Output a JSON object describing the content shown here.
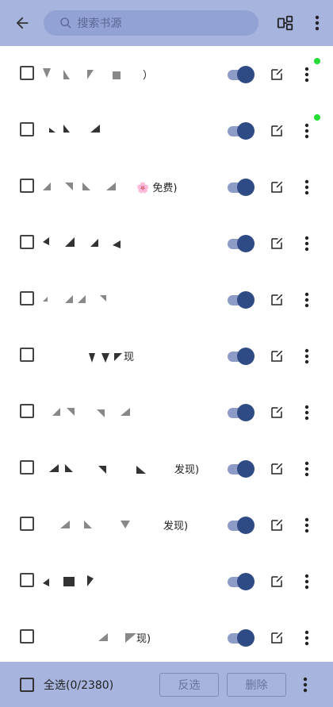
{
  "header": {
    "back_icon": "arrow-back-icon",
    "search_placeholder": "搜索书源",
    "search_icon": "search-icon",
    "group_icon": "group-icon",
    "menu_icon": "more-vertical-icon"
  },
  "rows": [
    {
      "name_suffix": "）",
      "enabled": true,
      "has_dot": true
    },
    {
      "name_suffix": "",
      "enabled": true,
      "has_dot": true
    },
    {
      "name_suffix": "🌸 免费)",
      "enabled": true,
      "has_dot": false
    },
    {
      "name_suffix": "",
      "enabled": true,
      "has_dot": false
    },
    {
      "name_suffix": "",
      "enabled": true,
      "has_dot": false
    },
    {
      "name_suffix": "现",
      "enabled": true,
      "has_dot": false
    },
    {
      "name_suffix": "",
      "enabled": true,
      "has_dot": false
    },
    {
      "name_suffix": "发现)",
      "enabled": true,
      "has_dot": false
    },
    {
      "name_suffix": "发现)",
      "enabled": true,
      "has_dot": false
    },
    {
      "name_suffix": "",
      "enabled": true,
      "has_dot": false
    },
    {
      "name_suffix": "现)",
      "enabled": true,
      "has_dot": false
    }
  ],
  "footer": {
    "select_all": "全选(0/2380)",
    "invert_label": "反选",
    "delete_label": "删除",
    "menu_icon": "more-vertical-icon"
  },
  "colors": {
    "bar_background": "#a6b4de",
    "toggle_on": "#2f4b86",
    "status_dot": "#22dd33"
  }
}
